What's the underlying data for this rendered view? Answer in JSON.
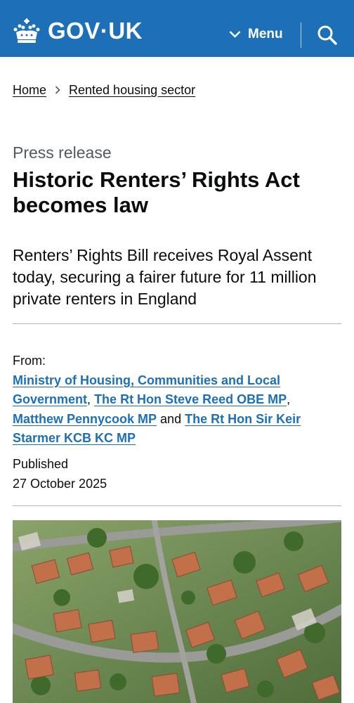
{
  "header": {
    "logo_text": "GOV·UK",
    "menu_label": "Menu",
    "brand_color": "#1d70b8"
  },
  "breadcrumb": {
    "items": [
      "Home",
      "Rented housing sector"
    ]
  },
  "page": {
    "caption": "Press release",
    "title": "Historic Renters’ Rights Act becomes law",
    "lead": "Renters’ Rights Bill receives Royal Assent today, securing a fairer future for 11 million private renters in England"
  },
  "meta": {
    "from_label": "From:",
    "organisations": [
      "Ministry of Housing, Communities and Local Government",
      "The Rt Hon Steve Reed OBE MP",
      "Matthew Pennycook MP",
      "The Rt Hon Sir Keir Starmer KCB KC MP"
    ],
    "separator_comma": ",",
    "separator_and": "and",
    "published_label": "Published",
    "published_date": "27 October 2025"
  },
  "icons": {
    "logo": "crown-icon",
    "menu": "chevron-down-icon",
    "search": "search-icon",
    "breadcrumb_separator": "chevron-right-icon"
  }
}
